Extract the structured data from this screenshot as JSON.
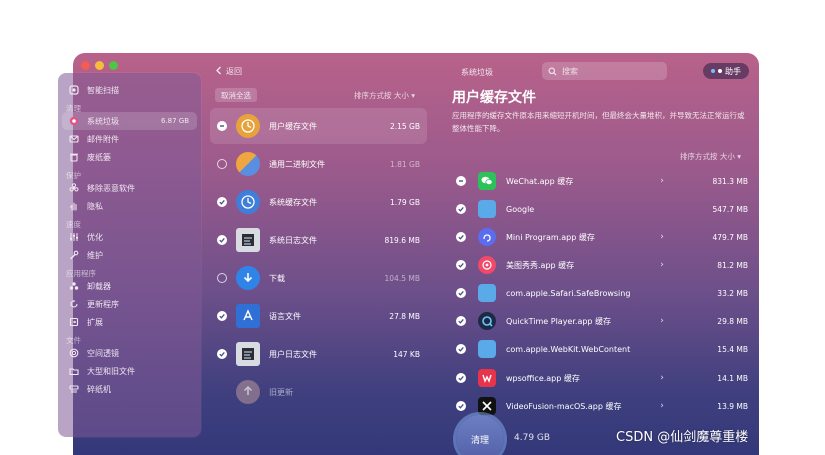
{
  "sidebar": {
    "smart_scan": "智能扫描",
    "sec_cleanup": "清理",
    "system_junk": "系统垃圾",
    "system_junk_size": "6.87 GB",
    "mail_attachments": "邮件附件",
    "trash": "废纸篓",
    "sec_protection": "保护",
    "malware_removal": "移除恶意软件",
    "privacy": "隐私",
    "sec_speed": "速度",
    "optimization": "优化",
    "maintenance": "维护",
    "sec_apps": "应用程序",
    "uninstaller": "卸载器",
    "updater": "更新程序",
    "extensions": "扩展",
    "sec_files": "文件",
    "space_lens": "空间透镜",
    "large_old_files": "大型和旧文件",
    "shredder": "碎纸机"
  },
  "header": {
    "back_label": "返回",
    "title": "系统垃圾",
    "search_placeholder": "搜索",
    "assistant_label": "助手"
  },
  "middle": {
    "deselect_all": "取消全选",
    "sort_label": "排序方式按 大小 ▾",
    "items": [
      {
        "name": "用户缓存文件",
        "size": "2.15 GB",
        "state": "partial"
      },
      {
        "name": "通用二进制文件",
        "size": "1.81 GB",
        "state": "off"
      },
      {
        "name": "系统缓存文件",
        "size": "1.79 GB",
        "state": "on"
      },
      {
        "name": "系统日志文件",
        "size": "819.6 MB",
        "state": "on"
      },
      {
        "name": "下载",
        "size": "104.5 MB",
        "state": "off"
      },
      {
        "name": "语言文件",
        "size": "27.8 MB",
        "state": "on"
      },
      {
        "name": "用户日志文件",
        "size": "147 KB",
        "state": "on"
      },
      {
        "name": "旧更新",
        "size": "",
        "state": "none"
      }
    ]
  },
  "right": {
    "title": "用户缓存文件",
    "description": "应用程序的缓存文件原本用来缩短开机时间，但最终会大量堆积，并导致无法正常运行或整体性能下降。",
    "sort_label": "排序方式按 大小 ▾",
    "items": [
      {
        "name": "WeChat.app 缓存",
        "size": "831.3 MB",
        "state": "partial",
        "chevron": true
      },
      {
        "name": "Google",
        "size": "547.7 MB",
        "state": "on",
        "chevron": false
      },
      {
        "name": "Mini Program.app 缓存",
        "size": "479.7 MB",
        "state": "on",
        "chevron": true
      },
      {
        "name": "美图秀秀.app 缓存",
        "size": "81.2 MB",
        "state": "on",
        "chevron": true
      },
      {
        "name": "com.apple.Safari.SafeBrowsing",
        "size": "33.2 MB",
        "state": "on",
        "chevron": false
      },
      {
        "name": "QuickTime Player.app 缓存",
        "size": "29.8 MB",
        "state": "on",
        "chevron": true
      },
      {
        "name": "com.apple.WebKit.WebContent",
        "size": "15.4 MB",
        "state": "on",
        "chevron": false
      },
      {
        "name": "wpsoffice.app 缓存",
        "size": "14.1 MB",
        "state": "on",
        "chevron": true
      },
      {
        "name": "VideoFusion-macOS.app 缓存",
        "size": "13.9 MB",
        "state": "on",
        "chevron": true
      }
    ],
    "chevron_glyph": "›"
  },
  "footer": {
    "clean_label": "清理",
    "total_size": "4.79 GB"
  },
  "watermark": "CSDN @仙剑魔尊重楼",
  "colors": {
    "window_top": "#b8628a",
    "window_bottom": "#33387a",
    "clean_button": "#6d7fc2"
  },
  "icons": {
    "back": "chevron-left-icon",
    "search": "magnifier-icon"
  }
}
